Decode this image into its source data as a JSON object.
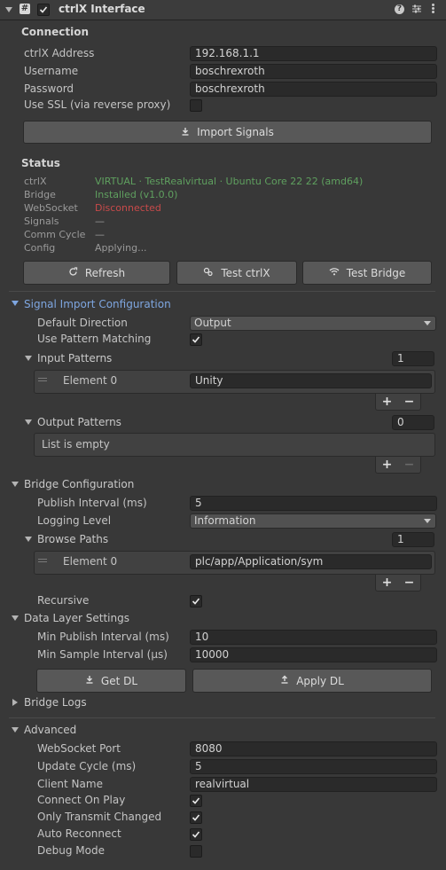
{
  "header": {
    "title": "ctrlX Interface",
    "component_icon": "script-icon",
    "enabled": true
  },
  "connection": {
    "title": "Connection",
    "address_label": "ctrlX Address",
    "address_value": "192.168.1.1",
    "username_label": "Username",
    "username_value": "boschrexroth",
    "password_label": "Password",
    "password_value": "boschrexroth",
    "ssl_label": "Use SSL (via reverse proxy)",
    "ssl_checked": false,
    "import_button": "Import Signals"
  },
  "status": {
    "title": "Status",
    "rows": [
      {
        "label": "ctrlX",
        "value": "VIRTUAL · TestRealvirtual · Ubuntu Core 22 22 (amd64)",
        "color": "#5fa05f"
      },
      {
        "label": "Bridge",
        "value": "Installed (v1.0.0)",
        "color": "#5fa05f"
      },
      {
        "label": "WebSocket",
        "value": "Disconnected",
        "color": "#c84a4a"
      },
      {
        "label": "Signals",
        "value": "—",
        "color": "#9a9a9a"
      },
      {
        "label": "Comm Cycle",
        "value": "—",
        "color": "#9a9a9a"
      },
      {
        "label": "Config",
        "value": "Applying...",
        "color": "#9a9a9a"
      }
    ],
    "refresh_button": "Refresh",
    "test_ctrlx_button": "Test ctrlX",
    "test_bridge_button": "Test Bridge"
  },
  "signal_import": {
    "title": "Signal Import Configuration",
    "direction_label": "Default Direction",
    "direction_value": "Output",
    "pattern_label": "Use Pattern Matching",
    "pattern_checked": true,
    "input_patterns_label": "Input Patterns",
    "input_patterns_count": "1",
    "input_element_label": "Element 0",
    "input_element_value": "Unity",
    "output_patterns_label": "Output Patterns",
    "output_patterns_count": "0",
    "empty_text": "List is empty"
  },
  "bridge": {
    "title": "Bridge Configuration",
    "publish_label": "Publish Interval (ms)",
    "publish_value": "5",
    "logging_label": "Logging Level",
    "logging_value": "Information",
    "browse_label": "Browse Paths",
    "browse_count": "1",
    "browse_element_label": "Element 0",
    "browse_element_value": "plc/app/Application/sym",
    "recursive_label": "Recursive",
    "recursive_checked": true
  },
  "data_layer": {
    "title": "Data Layer Settings",
    "min_publish_label": "Min Publish Interval (ms)",
    "min_publish_value": "10",
    "min_sample_label": "Min Sample Interval (µs)",
    "min_sample_value": "10000",
    "get_button": "Get DL",
    "apply_button": "Apply DL"
  },
  "bridge_logs": {
    "title": "Bridge Logs"
  },
  "advanced": {
    "title": "Advanced",
    "ws_port_label": "WebSocket Port",
    "ws_port_value": "8080",
    "update_label": "Update Cycle (ms)",
    "update_value": "5",
    "client_label": "Client Name",
    "client_value": "realvirtual",
    "connect_label": "Connect On Play",
    "connect_checked": true,
    "transmit_label": "Only Transmit Changed",
    "transmit_checked": true,
    "reconnect_label": "Auto Reconnect",
    "reconnect_checked": true,
    "debug_label": "Debug Mode",
    "debug_checked": false
  }
}
